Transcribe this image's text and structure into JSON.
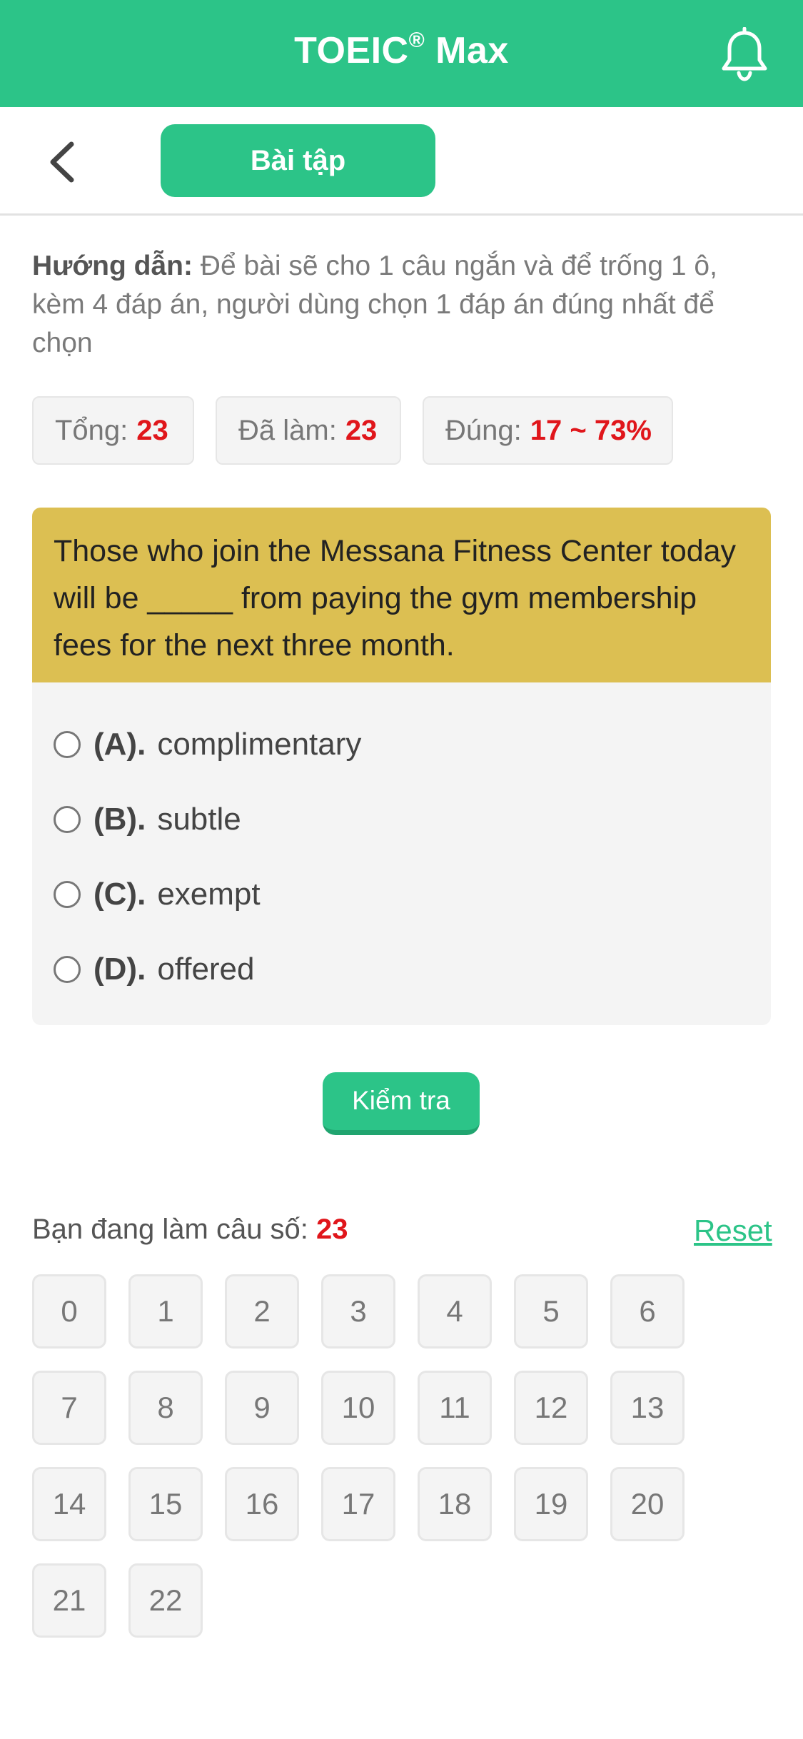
{
  "app": {
    "title": "TOEIC",
    "title_sup": "®",
    "title_suffix": " Max",
    "accent_color": "#2cc488",
    "highlight_color": "#e0161b",
    "question_bg": "#dcbf52"
  },
  "subbar": {
    "tab_label": "Bài tập",
    "back_icon": "chevron-left-icon"
  },
  "guide": {
    "label": "Hướng dẫn:",
    "text": " Để bài sẽ cho 1 câu ngắn và để trống 1 ô, kèm 4 đáp án, người dùng chọn 1 đáp án đúng nhất để chọn"
  },
  "stats": {
    "total_label": "Tổng:",
    "total_value": "23",
    "done_label": "Đã làm:",
    "done_value": "23",
    "correct_label": "Đúng:",
    "correct_value": "17 ~ 73%"
  },
  "question": {
    "text": "Those who join the Messana Fitness Center today will be _____ from paying the gym membership fees for the next three month.",
    "options": [
      {
        "letter": "(A).",
        "text": "complimentary"
      },
      {
        "letter": "(B).",
        "text": "subtle"
      },
      {
        "letter": "(C).",
        "text": "exempt"
      },
      {
        "letter": "(D).",
        "text": "offered"
      }
    ]
  },
  "check_button": "Kiểm tra",
  "progress": {
    "label": "Bạn đang làm câu số: ",
    "current": "23",
    "reset_label": "Reset"
  },
  "question_numbers": [
    "0",
    "1",
    "2",
    "3",
    "4",
    "5",
    "6",
    "7",
    "8",
    "9",
    "10",
    "11",
    "12",
    "13",
    "14",
    "15",
    "16",
    "17",
    "18",
    "19",
    "20",
    "21",
    "22"
  ]
}
